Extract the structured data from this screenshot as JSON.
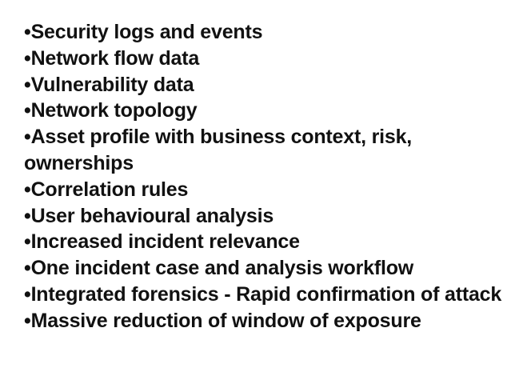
{
  "bullet_char": "•",
  "items": [
    "Security logs and events",
    "Network flow data",
    "Vulnerability data",
    "Network topology",
    "Asset profile with business context, risk, ownerships",
    "Correlation rules",
    "User behavioural analysis",
    "Increased incident relevance",
    "One incident case and analysis workflow",
    "Integrated forensics - Rapid confirmation of attack",
    "Massive reduction of window of exposure"
  ]
}
